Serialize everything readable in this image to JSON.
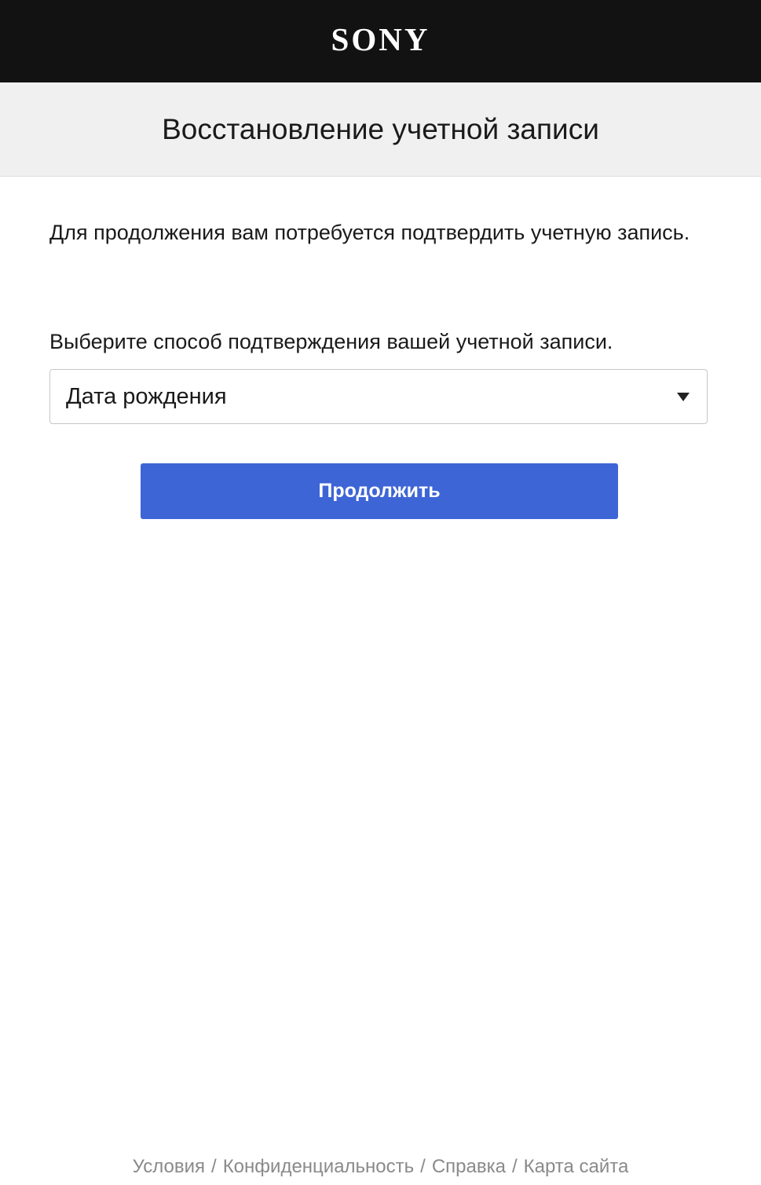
{
  "header": {
    "logo_text": "SONY"
  },
  "title": "Восстановление учетной записи",
  "intro_text": "Для продолжения вам потребуется подтвердить учетную запись.",
  "method": {
    "label": "Выберите способ подтверждения вашей учетной записи.",
    "selected": "Дата рождения"
  },
  "continue_button": "Продолжить",
  "footer": {
    "links": [
      "Условия",
      "Конфиденциальность",
      "Справка",
      "Карта сайта"
    ],
    "separator": "/"
  },
  "colors": {
    "topbar": "#121212",
    "titlebar": "#f0f0f0",
    "button": "#3e65d6",
    "footer_text": "#8a8a8a"
  }
}
